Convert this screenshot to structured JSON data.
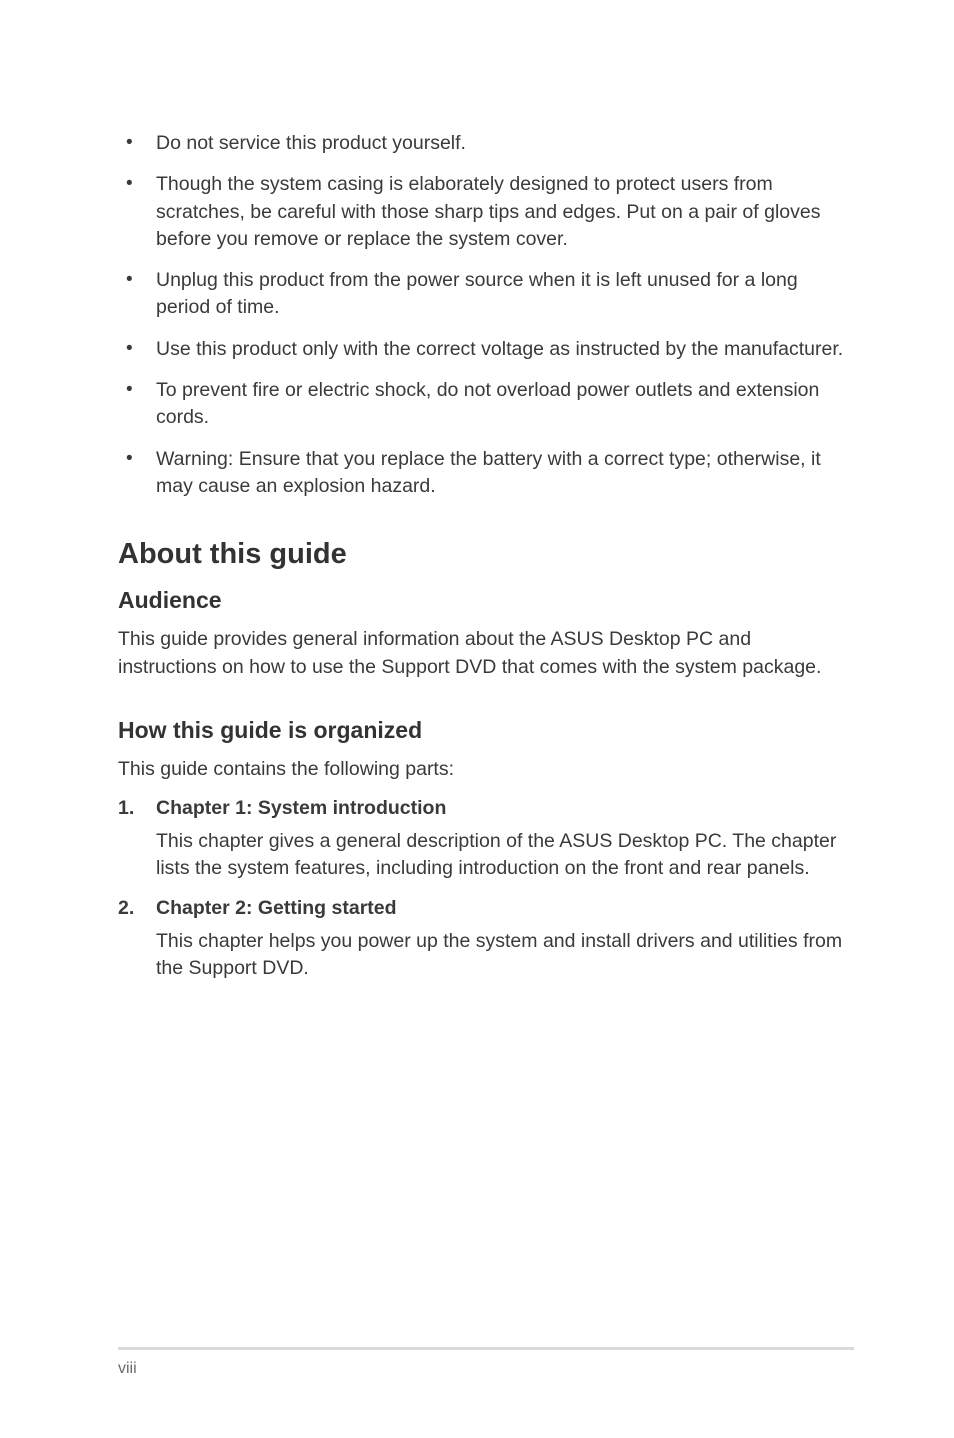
{
  "bullets": [
    "Do not service this product yourself.",
    "Though the system casing is elaborately designed to protect users from scratches, be careful with those sharp tips and edges. Put on a pair of gloves before you remove or replace the system cover.",
    "Unplug this product from the power source when it is left unused for a long period of time.",
    "Use this product only with the correct voltage as instructed by the manufacturer.",
    "To prevent fire or electric shock, do not overload power outlets and extension cords.",
    "Warning: Ensure that you replace the battery with a correct type; otherwise, it may cause an explosion hazard."
  ],
  "heading_about": "About this guide",
  "audience": {
    "title": "Audience",
    "body": "This guide provides general information about the ASUS Desktop PC and instructions on how to use the Support DVD that comes with the system package."
  },
  "organized": {
    "title": "How this guide is organized",
    "intro": "This guide contains the following parts:",
    "items": [
      {
        "num": "1.",
        "title": "Chapter 1: System introduction",
        "body": "This chapter gives a general description of the ASUS Desktop PC. The chapter lists the system features, including introduction on the front and rear panels."
      },
      {
        "num": "2.",
        "title": "Chapter 2: Getting started",
        "body": "This chapter helps you power up the system and install drivers and utilities from the Support DVD."
      }
    ]
  },
  "page_number": "viii"
}
